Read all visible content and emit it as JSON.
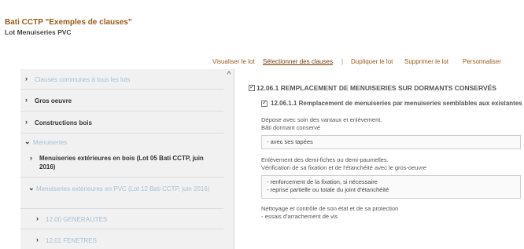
{
  "header": {
    "title": "Bati CCTP \"Exemples de clauses\"",
    "subtitle": "Lot Menuiseries PVC"
  },
  "toolbar": {
    "view_lot": "Visualiser le lot",
    "select_clauses": "Sélectionner des clauses",
    "separator": "|",
    "duplicate_lot": "Dupliquer le lot",
    "delete_lot": "Supprimer le lot",
    "personalize": "Personnaliser"
  },
  "sidebar": {
    "items": [
      {
        "label": "Clauses communes à tous les lots",
        "chevron": "›"
      },
      {
        "label": "Gros oeuvre",
        "chevron": "›"
      },
      {
        "label": "Constructions bois",
        "chevron": "›"
      },
      {
        "label": "Menuiseries",
        "chevron": "⌄"
      },
      {
        "label": "Menuiseries extérieures en bois (Lot 05 Bati CCTP, juin 2016)",
        "chevron": "›"
      },
      {
        "label": "Menuiseries extérieures en PVC (Lot 12 Bati CCTP, juin 2016)",
        "chevron": "⌄"
      },
      {
        "label": "12.00 GENERALITES",
        "chevron": "›"
      },
      {
        "label": "12.01 FENETRES",
        "chevron": "›"
      }
    ],
    "scroll_up": "^"
  },
  "main": {
    "section_title": "12.06.1 REMPLACEMENT DE MENUISERIES SUR DORMANTS CONSERVÉS",
    "clause_title": "12.06.1.1 Remplacement de menuiseries par menuiseries semblables aux existantes",
    "para1_line1": "Dépose avec soin des vantaux et enlèvement.",
    "para1_line2": "Bâti dormant conservé",
    "box1": "- avec ses tapées",
    "para2_line1": "Enlèvement des demi-fiches ou demi-paumelles.",
    "para2_line2": "Vérification de sa fixation et de l'étanchéité avec le gros-oeuvre",
    "box2_line1": "- renforcement de la fixation, si nécessaire",
    "box2_line2": "- reprise partielle ou totale du joint d'étanchéité",
    "para3_line1": "Nettoyage et contrôle de son état et de sa protection",
    "para3_line2": "- essais d'arrachement de vis"
  }
}
